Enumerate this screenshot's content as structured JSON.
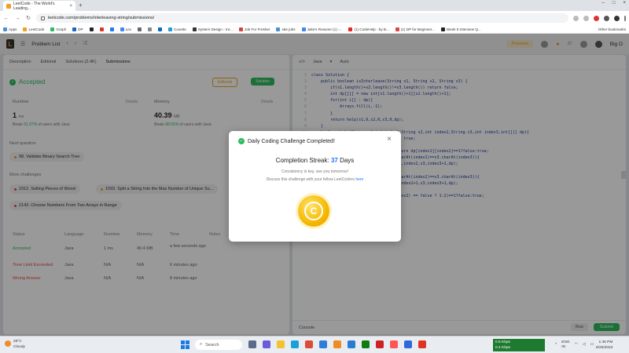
{
  "browser": {
    "tab_title": "LeetCode - The World's Leading...",
    "url": "leetcode.com/problems/interleaving-string/submissions/",
    "bookmarks": [
      "Apps",
      "LeetCode",
      "Graph",
      "DP",
      "",
      "",
      "",
      "Lex",
      "",
      "",
      "",
      "Cuvette",
      "System Design - Int...",
      "Job For Fresher",
      "sde jobs",
      "Jake's Resume (1) -...",
      "(1) CodeHelp - by B...",
      "(1) DP for Beginner...",
      "Week 8 Interview Q..."
    ],
    "other_bookmarks": "Other bookmarks"
  },
  "header": {
    "title": "Problem List",
    "premium": "Premium",
    "streak_count": "37",
    "user": "Big O"
  },
  "left": {
    "tabs": [
      "Description",
      "Editorial",
      "Solutions (2.4K)",
      "Submissions"
    ],
    "status": "Accepted",
    "editorial_btn": "Editorial",
    "solution_btn": "Solution",
    "runtime_label": "Runtime",
    "runtime_detail": "Details",
    "runtime_value": "1",
    "runtime_unit": "ms",
    "runtime_beats_pct": "91.97%",
    "runtime_beats_text": "of users with Java",
    "memory_label": "Memory",
    "memory_detail": "Details",
    "memory_value": "40.39",
    "memory_unit": "MB",
    "memory_beats_pct": "98.55%",
    "memory_beats_text": "of users with Java",
    "beats_word": "Beats",
    "next_question_label": "Next question",
    "next_question": "98. Validate Binary Search Tree",
    "more_challenges_label": "More challenges",
    "challenges": [
      "2312. Selling Pieces of Wood",
      "1593. Split a String Into the Max Number of Unique Su...",
      "2143. Choose Numbers From Two Arrays in Range"
    ],
    "table_headers": [
      "Status",
      "Language",
      "Runtime",
      "Memory",
      "Time",
      "Notes"
    ],
    "rows": [
      {
        "status": "Accepted",
        "language": "Java",
        "runtime": "1 ms",
        "memory": "40.4 MB",
        "time": "a few seconds ago"
      },
      {
        "status": "Time Limit Exceeded",
        "language": "Java",
        "runtime": "N/A",
        "memory": "N/A",
        "time": "6 minutes ago"
      },
      {
        "status": "Wrong Answer",
        "language": "Java",
        "runtime": "N/A",
        "memory": "N/A",
        "time": "8 minutes ago"
      }
    ]
  },
  "editor": {
    "language": "Java",
    "mode": "Auto",
    "code_lines": [
      "class Solution {",
      "    public boolean isInterleave(String s1, String s2, String s3) {",
      "        if(s1.length()+s2.length()!=s3.length()) return false;",
      "        int dp[][] = new int[s1.length()+1][s2.length()+1];",
      "        for(int i[] : dp){",
      "            Arrays.fill(i,-1);",
      "        }",
      "        return help(s1,0,s2,0,s3,0,dp);",
      "    }",
      "    boolean help(String s1,int index1,String s2,int index2,String s3,int index3,int[][] dp){",
      "        if(index3==s3.length()) return true;",
      "",
      "        if(dp[index1][index2]!=-1) return dp[index1][index2]==1?false:true;",
      "        if(index1<s1.length() && s1.charAt(index1)==s3.charAt(index3)){",
      "            ans1 = help(s1,index1+1,s2,index2,s3,index3+1,dp);",
      "        }",
      "        if(index2<s2.length() && s2.charAt(index2)==s3.charAt(index3)){",
      "            ans2 = help(s1,index1,s2,index2+1,s3,index3+1,dp);",
      "        }",
      "        dp[index1][index2] = ((ans1||ans2) == false ? 1:2)==1?false:true;",
      "    }",
      "}"
    ],
    "console": "Console",
    "run": "Run",
    "submit": "Submit"
  },
  "modal": {
    "title": "Daily Coding Challenge Completed!",
    "streak_prefix": "Completion Streak:",
    "streak_days": "37",
    "streak_suffix": "Days",
    "consistency": "Consistency is key, see you tomorrow!",
    "discuss_prefix": "Discuss this challenge with your fellow LeetCoders",
    "discuss_link": "here"
  },
  "taskbar": {
    "temp": "28°C",
    "weather": "Cloudy",
    "search": "Search",
    "net_up": "0.5 Kbps",
    "net_down": "0.4 Kbps",
    "lang1": "ENG",
    "lang2": "IN",
    "time": "1:45 PM",
    "date": "8/25/2023"
  },
  "colors": {
    "accent_green": "#2cbb5d",
    "accent_orange": "#f0a020",
    "link_blue": "#2176ff",
    "error_red": "#ef4743"
  }
}
